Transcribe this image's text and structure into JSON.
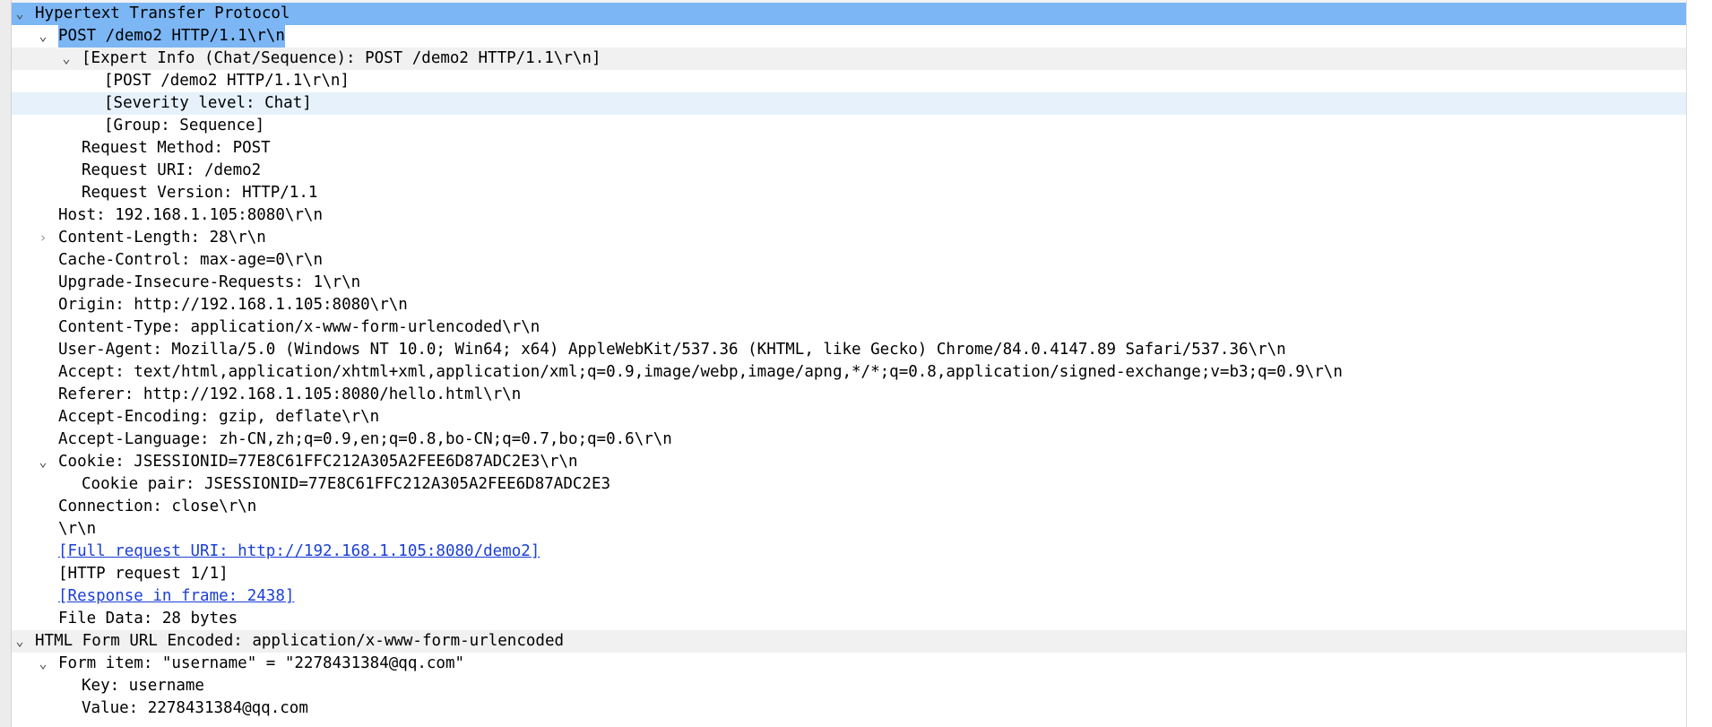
{
  "packet_details": {
    "http": {
      "label": "Hypertext Transfer Protocol",
      "request_line": {
        "label": "POST /demo2 HTTP/1.1\\r\\n",
        "expert_info": {
          "label": "[Expert Info (Chat/Sequence): POST /demo2 HTTP/1.1\\r\\n]",
          "children": [
            "[POST /demo2 HTTP/1.1\\r\\n]",
            "[Severity level: Chat]",
            "[Group: Sequence]"
          ]
        },
        "method": "Request Method: POST",
        "uri": "Request URI: /demo2",
        "version": "Request Version: HTTP/1.1"
      },
      "host": "Host: 192.168.1.105:8080\\r\\n",
      "content_length": "Content-Length: 28\\r\\n",
      "cache_control": "Cache-Control: max-age=0\\r\\n",
      "upgrade_insecure": "Upgrade-Insecure-Requests: 1\\r\\n",
      "origin": "Origin: http://192.168.1.105:8080\\r\\n",
      "content_type": "Content-Type: application/x-www-form-urlencoded\\r\\n",
      "user_agent": "User-Agent: Mozilla/5.0 (Windows NT 10.0; Win64; x64) AppleWebKit/537.36 (KHTML, like Gecko) Chrome/84.0.4147.89 Safari/537.36\\r\\n",
      "accept": "Accept: text/html,application/xhtml+xml,application/xml;q=0.9,image/webp,image/apng,*/*;q=0.8,application/signed-exchange;v=b3;q=0.9\\r\\n",
      "referer": "Referer: http://192.168.1.105:8080/hello.html\\r\\n",
      "accept_encoding": "Accept-Encoding: gzip, deflate\\r\\n",
      "accept_language": "Accept-Language: zh-CN,zh;q=0.9,en;q=0.8,bo-CN;q=0.7,bo;q=0.6\\r\\n",
      "cookie": {
        "label": "Cookie: JSESSIONID=77E8C61FFC212A305A2FEE6D87ADC2E3\\r\\n",
        "pair": "Cookie pair: JSESSIONID=77E8C61FFC212A305A2FEE6D87ADC2E3"
      },
      "connection": "Connection: close\\r\\n",
      "crlf": "\\r\\n",
      "full_request_uri": "[Full request URI: http://192.168.1.105:8080/demo2]",
      "http_request": "[HTTP request 1/1]",
      "response_in_frame": "[Response in frame: 2438]",
      "file_data": "File Data: 28 bytes"
    },
    "form": {
      "label": "HTML Form URL Encoded: application/x-www-form-urlencoded",
      "item": {
        "label": "Form item: \"username\" = \"2278431384@qq.com\"",
        "key": "Key: username",
        "value": "Value: 2278431384@qq.com"
      }
    }
  },
  "icons": {
    "expanded": "chevron-down-icon",
    "collapsed": "chevron-right-icon"
  },
  "colors": {
    "selection": "#7cb6f5",
    "hover": "#e6f1fc",
    "protocol_row": "#f1f1f1",
    "link": "#1b3fd6"
  }
}
